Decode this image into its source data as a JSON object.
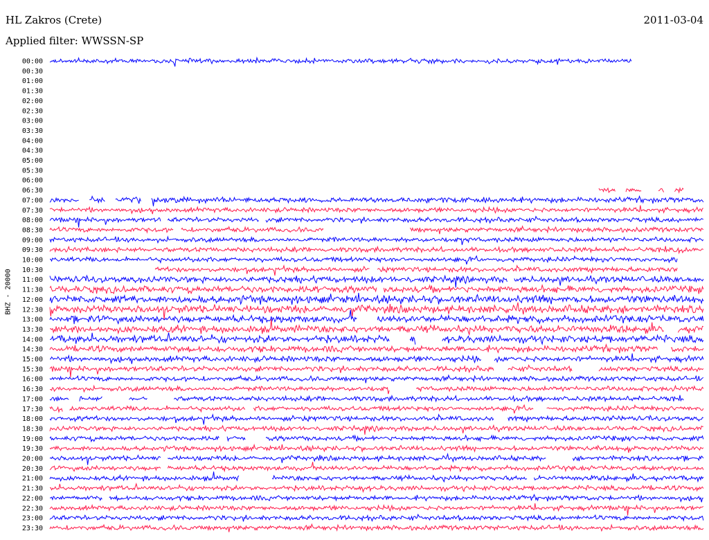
{
  "header": {
    "station": "HL Zakros (Crete)",
    "date": "2011-03-04",
    "filter": "Applied filter: WWSSN-SP"
  },
  "chart_data": {
    "type": "line",
    "title": "HL Zakros (Crete)",
    "channel_label": "BHZ - 20000",
    "colors": [
      "#0000ff",
      "#ff1a4a"
    ],
    "rows": [
      {
        "time": "00:00",
        "span": [
          0,
          0.89
        ],
        "amp": 1.0,
        "gaps": []
      },
      {
        "time": "00:30",
        "span": null,
        "amp": 0,
        "gaps": []
      },
      {
        "time": "01:00",
        "span": null,
        "amp": 0,
        "gaps": []
      },
      {
        "time": "01:30",
        "span": null,
        "amp": 0,
        "gaps": []
      },
      {
        "time": "02:00",
        "span": null,
        "amp": 0,
        "gaps": []
      },
      {
        "time": "02:30",
        "span": null,
        "amp": 0,
        "gaps": []
      },
      {
        "time": "03:00",
        "span": null,
        "amp": 0,
        "gaps": []
      },
      {
        "time": "03:30",
        "span": null,
        "amp": 0,
        "gaps": []
      },
      {
        "time": "04:00",
        "span": null,
        "amp": 0,
        "gaps": []
      },
      {
        "time": "04:30",
        "span": null,
        "amp": 0,
        "gaps": []
      },
      {
        "time": "05:00",
        "span": null,
        "amp": 0,
        "gaps": []
      },
      {
        "time": "05:30",
        "span": null,
        "amp": 0,
        "gaps": []
      },
      {
        "time": "06:00",
        "span": null,
        "amp": 0,
        "gaps": []
      },
      {
        "time": "06:30",
        "span": [
          0.84,
          0.97
        ],
        "amp": 0.9,
        "gaps": [
          [
            0.865,
            0.88
          ],
          [
            0.905,
            0.93
          ],
          [
            0.94,
            0.955
          ]
        ]
      },
      {
        "time": "07:00",
        "span": [
          0,
          1
        ],
        "amp": 1.1,
        "gaps": [
          [
            0.045,
            0.06
          ],
          [
            0.085,
            0.1
          ],
          [
            0.14,
            0.155
          ]
        ]
      },
      {
        "time": "07:30",
        "span": [
          0,
          1
        ],
        "amp": 1.0,
        "gaps": []
      },
      {
        "time": "08:00",
        "span": [
          0,
          1
        ],
        "amp": 1.0,
        "gaps": [
          [
            0.17,
            0.18
          ],
          [
            0.32,
            0.33
          ]
        ]
      },
      {
        "time": "08:30",
        "span": [
          0,
          1
        ],
        "amp": 1.0,
        "gaps": [
          [
            0.19,
            0.2
          ],
          [
            0.42,
            0.55
          ]
        ]
      },
      {
        "time": "09:00",
        "span": [
          0,
          1
        ],
        "amp": 1.0,
        "gaps": []
      },
      {
        "time": "09:30",
        "span": [
          0,
          1
        ],
        "amp": 1.0,
        "gaps": []
      },
      {
        "time": "10:00",
        "span": [
          0,
          0.96
        ],
        "amp": 1.0,
        "gaps": []
      },
      {
        "time": "10:30",
        "span": [
          0,
          1
        ],
        "amp": 1.0,
        "gaps": [
          [
            0,
            0.16
          ],
          [
            0.49,
            0.5
          ],
          [
            0.96,
            1.0
          ]
        ]
      },
      {
        "time": "11:00",
        "span": [
          0,
          1
        ],
        "amp": 1.3,
        "gaps": [
          [
            0.7,
            0.71
          ]
        ]
      },
      {
        "time": "11:30",
        "span": [
          0,
          1
        ],
        "amp": 1.4,
        "gaps": [
          [
            0.5,
            0.51
          ]
        ]
      },
      {
        "time": "12:00",
        "span": [
          0,
          1
        ],
        "amp": 1.6,
        "gaps": []
      },
      {
        "time": "12:30",
        "span": [
          0,
          1
        ],
        "amp": 1.6,
        "gaps": []
      },
      {
        "time": "13:00",
        "span": [
          0,
          1
        ],
        "amp": 1.5,
        "gaps": [
          [
            0.47,
            0.5
          ]
        ]
      },
      {
        "time": "13:30",
        "span": [
          0,
          1
        ],
        "amp": 1.5,
        "gaps": [
          [
            0.94,
            0.96
          ]
        ]
      },
      {
        "time": "14:00",
        "span": [
          0,
          1
        ],
        "amp": 1.5,
        "gaps": [
          [
            0.52,
            0.55
          ],
          [
            0.56,
            0.6
          ]
        ]
      },
      {
        "time": "14:30",
        "span": [
          0,
          1
        ],
        "amp": 1.3,
        "gaps": [
          [
            0.93,
            0.95
          ]
        ]
      },
      {
        "time": "15:00",
        "span": [
          0,
          1
        ],
        "amp": 1.2,
        "gaps": [
          [
            0.66,
            0.68
          ]
        ]
      },
      {
        "time": "15:30",
        "span": [
          0,
          1
        ],
        "amp": 1.1,
        "gaps": [
          [
            0.68,
            0.7
          ],
          [
            0.8,
            0.84
          ]
        ]
      },
      {
        "time": "16:00",
        "span": [
          0,
          1
        ],
        "amp": 1.0,
        "gaps": []
      },
      {
        "time": "16:30",
        "span": [
          0,
          1
        ],
        "amp": 1.0,
        "gaps": [
          [
            0.52,
            0.56
          ]
        ]
      },
      {
        "time": "17:00",
        "span": [
          0,
          0.97
        ],
        "amp": 1.0,
        "gaps": [
          [
            0.03,
            0.045
          ],
          [
            0.08,
            0.12
          ],
          [
            0.15,
            0.19
          ]
        ]
      },
      {
        "time": "17:30",
        "span": [
          0,
          1
        ],
        "amp": 1.0,
        "gaps": [
          [
            0.02,
            0.03
          ],
          [
            0.3,
            0.31
          ],
          [
            0.74,
            0.76
          ]
        ]
      },
      {
        "time": "18:00",
        "span": [
          0,
          1
        ],
        "amp": 1.0,
        "gaps": [
          [
            0.68,
            0.7
          ]
        ]
      },
      {
        "time": "18:30",
        "span": [
          0,
          1
        ],
        "amp": 1.0,
        "gaps": []
      },
      {
        "time": "19:00",
        "span": [
          0,
          1
        ],
        "amp": 1.0,
        "gaps": [
          [
            0.26,
            0.27
          ],
          [
            0.3,
            0.33
          ]
        ]
      },
      {
        "time": "19:30",
        "span": [
          0,
          1
        ],
        "amp": 1.0,
        "gaps": []
      },
      {
        "time": "20:00",
        "span": [
          0,
          1
        ],
        "amp": 1.0,
        "gaps": [
          [
            0.17,
            0.18
          ],
          [
            0.76,
            0.8
          ]
        ]
      },
      {
        "time": "20:30",
        "span": [
          0,
          1
        ],
        "amp": 1.0,
        "gaps": [
          [
            0.17,
            0.18
          ]
        ]
      },
      {
        "time": "21:00",
        "span": [
          0,
          1
        ],
        "amp": 1.0,
        "gaps": [
          [
            0.29,
            0.34
          ],
          [
            0.73,
            0.74
          ]
        ]
      },
      {
        "time": "21:30",
        "span": [
          0,
          1
        ],
        "amp": 1.0,
        "gaps": []
      },
      {
        "time": "22:00",
        "span": [
          0,
          1
        ],
        "amp": 1.0,
        "gaps": [
          [
            0.08,
            0.09
          ]
        ]
      },
      {
        "time": "22:30",
        "span": [
          0,
          1
        ],
        "amp": 1.0,
        "gaps": []
      },
      {
        "time": "23:00",
        "span": [
          0,
          1
        ],
        "amp": 1.0,
        "gaps": []
      },
      {
        "time": "23:30",
        "span": [
          0,
          1
        ],
        "amp": 1.0,
        "gaps": []
      }
    ]
  }
}
